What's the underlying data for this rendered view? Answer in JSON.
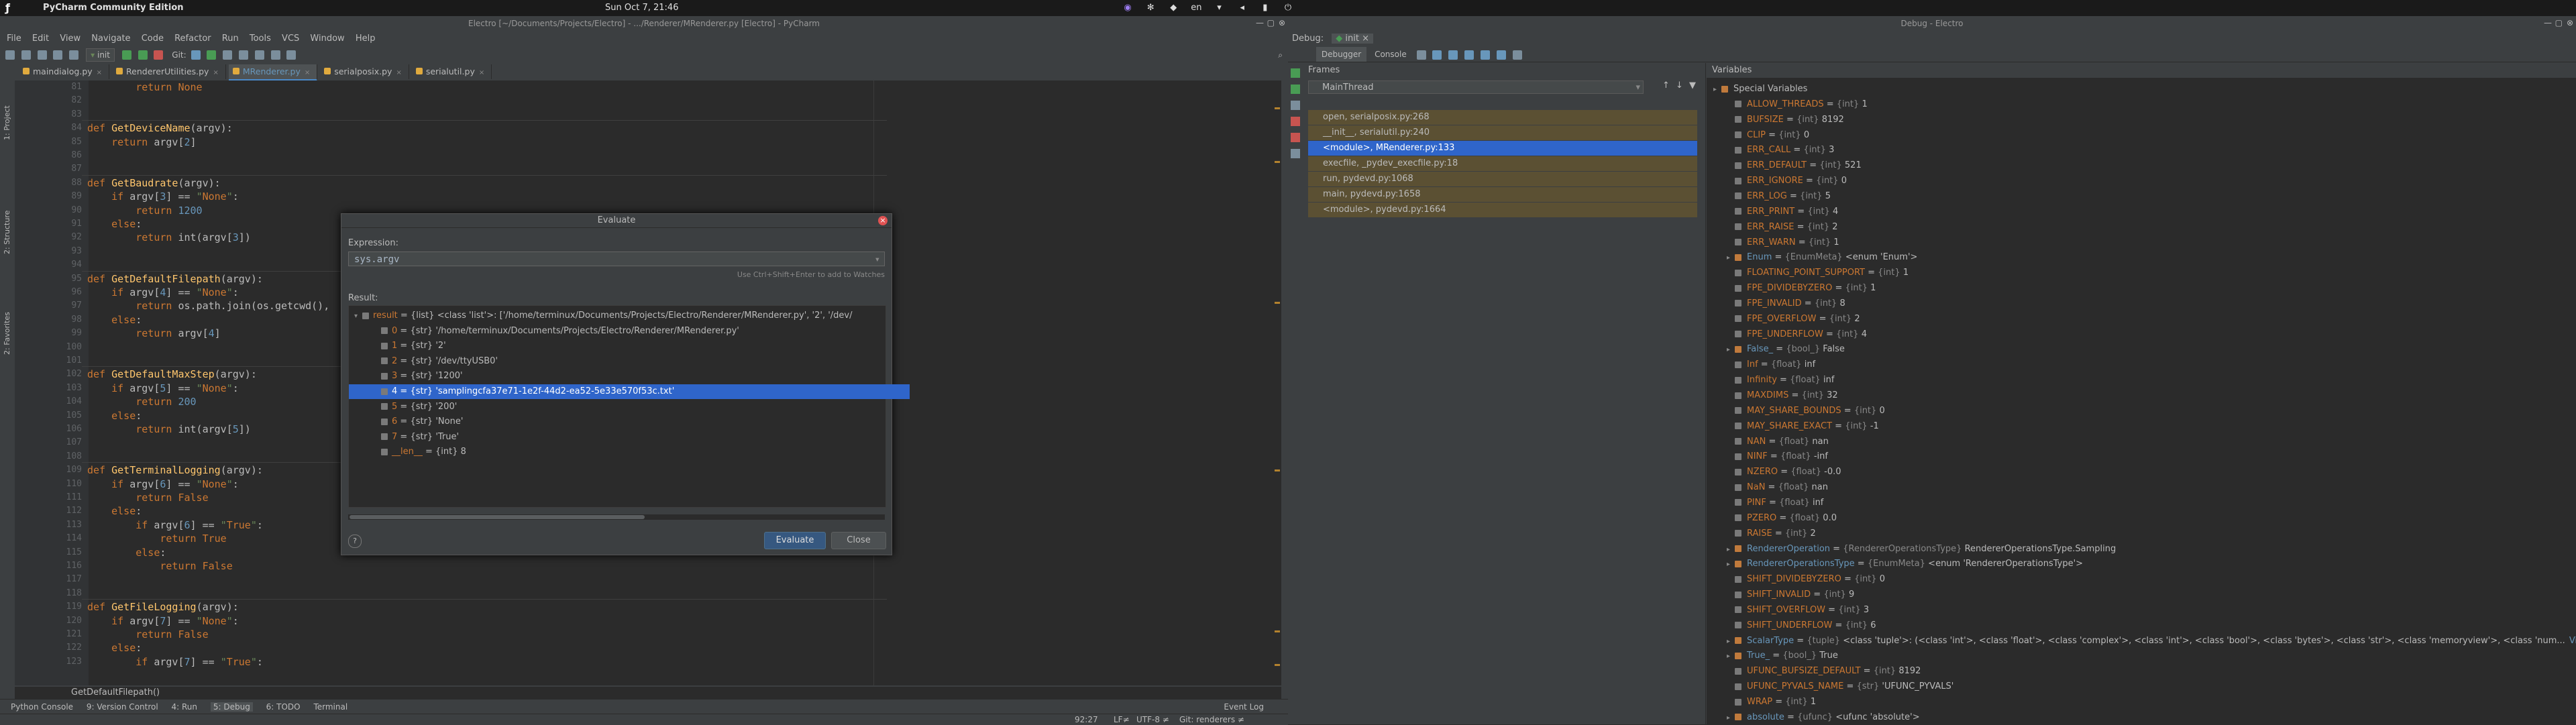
{
  "topbar": {
    "app_name": "PyCharm Community Edition",
    "clock": "Sun Oct  7, 21:46",
    "lang": "en"
  },
  "left_window": {
    "title": "Electro [~/Documents/Projects/Electro] - .../Renderer/MRenderer.py [Electro] - PyCharm",
    "menu": [
      "File",
      "Edit",
      "View",
      "Navigate",
      "Code",
      "Refactor",
      "Run",
      "Tools",
      "VCS",
      "Window",
      "Help"
    ],
    "run_config": "init",
    "git_label": "Git:",
    "tabs": [
      {
        "label": "maindialog.py",
        "active": false
      },
      {
        "label": "RendererUtilities.py",
        "active": false
      },
      {
        "label": "MRenderer.py",
        "active": true
      },
      {
        "label": "serialposix.py",
        "active": false
      },
      {
        "label": "serialutil.py",
        "active": false
      }
    ],
    "side_tools": [
      "1: Project",
      "2: Structure",
      "2: Favorites"
    ],
    "code_lines": [
      {
        "n": "81",
        "code": "        return None"
      },
      {
        "n": "82",
        "code": ""
      },
      {
        "n": "83",
        "code": ""
      },
      {
        "n": "84",
        "code": "def GetDeviceName(argv):"
      },
      {
        "n": "85",
        "code": "    return argv[2]"
      },
      {
        "n": "86",
        "code": ""
      },
      {
        "n": "87",
        "code": ""
      },
      {
        "n": "88",
        "code": "def GetBaudrate(argv):"
      },
      {
        "n": "89",
        "code": "    if argv[3] == \"None\":"
      },
      {
        "n": "90",
        "code": "        return 1200"
      },
      {
        "n": "91",
        "code": "    else:"
      },
      {
        "n": "92",
        "code": "        return int(argv[3])"
      },
      {
        "n": "93",
        "code": ""
      },
      {
        "n": "94",
        "code": ""
      },
      {
        "n": "95",
        "code": "def GetDefaultFilepath(argv):"
      },
      {
        "n": "96",
        "code": "    if argv[4] == \"None\":"
      },
      {
        "n": "97",
        "code": "        return os.path.join(os.getcwd(),"
      },
      {
        "n": "98",
        "code": "    else:"
      },
      {
        "n": "99",
        "code": "        return argv[4]"
      },
      {
        "n": "100",
        "code": ""
      },
      {
        "n": "101",
        "code": ""
      },
      {
        "n": "102",
        "code": "def GetDefaultMaxStep(argv):"
      },
      {
        "n": "103",
        "code": "    if argv[5] == \"None\":"
      },
      {
        "n": "104",
        "code": "        return 200"
      },
      {
        "n": "105",
        "code": "    else:"
      },
      {
        "n": "106",
        "code": "        return int(argv[5])"
      },
      {
        "n": "107",
        "code": ""
      },
      {
        "n": "108",
        "code": ""
      },
      {
        "n": "109",
        "code": "def GetTerminalLogging(argv):"
      },
      {
        "n": "110",
        "code": "    if argv[6] == \"None\":"
      },
      {
        "n": "111",
        "code": "        return False"
      },
      {
        "n": "112",
        "code": "    else:"
      },
      {
        "n": "113",
        "code": "        if argv[6] == \"True\":"
      },
      {
        "n": "114",
        "code": "            return True"
      },
      {
        "n": "115",
        "code": "        else:"
      },
      {
        "n": "116",
        "code": "            return False"
      },
      {
        "n": "117",
        "code": ""
      },
      {
        "n": "118",
        "code": ""
      },
      {
        "n": "119",
        "code": "def GetFileLogging(argv):"
      },
      {
        "n": "120",
        "code": "    if argv[7] == \"None\":"
      },
      {
        "n": "121",
        "code": "        return False"
      },
      {
        "n": "122",
        "code": "    else:"
      },
      {
        "n": "123",
        "code": "        if argv[7] == \"True\":"
      }
    ],
    "breadcrumb": "GetDefaultFilepath()",
    "bottom_tools": [
      "Python Console",
      "9: Version Control",
      "4: Run",
      "5: Debug",
      "6: TODO",
      "Terminal"
    ],
    "event_log": "Event Log",
    "status": {
      "position": "92:27",
      "line_sep": "LF≠",
      "encoding": "UTF-8 ≠",
      "git": "Git: renderers ≠"
    }
  },
  "dialog": {
    "title": "Evaluate",
    "expression_label": "Expression:",
    "expression": "sys.argv",
    "hint": "Use Ctrl+Shift+Enter to add to Watches",
    "result_label": "Result:",
    "result_rows": [
      {
        "name": "result",
        "text": " = {list} <class 'list'>: ['/home/terminux/Documents/Projects/Electro/Renderer/MRenderer.py', '2', '/dev/",
        "indent": 0,
        "expand": true,
        "selected": false
      },
      {
        "name": "0",
        "text": " = {str} '/home/terminux/Documents/Projects/Electro/Renderer/MRenderer.py'",
        "indent": 1,
        "expand": false,
        "selected": false
      },
      {
        "name": "1",
        "text": " = {str} '2'",
        "indent": 1,
        "expand": false,
        "selected": false
      },
      {
        "name": "2",
        "text": " = {str} '/dev/ttyUSB0'",
        "indent": 1,
        "expand": false,
        "selected": false
      },
      {
        "name": "3",
        "text": " = {str} '1200'",
        "indent": 1,
        "expand": false,
        "selected": false
      },
      {
        "name": "4",
        "text": " = {str} 'samplingcfa37e71-1e2f-44d2-ea52-5e33e570f53c.txt'",
        "indent": 1,
        "expand": false,
        "selected": true
      },
      {
        "name": "5",
        "text": " = {str} '200'",
        "indent": 1,
        "expand": false,
        "selected": false
      },
      {
        "name": "6",
        "text": " = {str} 'None'",
        "indent": 1,
        "expand": false,
        "selected": false
      },
      {
        "name": "7",
        "text": " = {str} 'True'",
        "indent": 1,
        "expand": false,
        "selected": false
      },
      {
        "name": "__len__",
        "text": " = {int} 8",
        "indent": 1,
        "expand": false,
        "selected": false
      }
    ],
    "help": "?",
    "evaluate_label": "Evaluate",
    "close_label": "Close"
  },
  "right_window": {
    "title": "Debug - Electro",
    "debug_label": "Debug:",
    "debug_config": "init",
    "tabs": [
      "Debugger",
      "Console"
    ],
    "frames_label": "Frames",
    "variables_label": "Variables",
    "thread": "MainThread",
    "frames": [
      {
        "label": "open, serialposix.py:268",
        "state": "normal"
      },
      {
        "label": "__init__, serialutil.py:240",
        "state": "normal"
      },
      {
        "label": "<module>, MRenderer.py:133",
        "state": "selected"
      },
      {
        "label": "execfile, _pydev_execfile.py:18",
        "state": "normal"
      },
      {
        "label": "run, pydevd.py:1068",
        "state": "normal"
      },
      {
        "label": "main, pydevd.py:1658",
        "state": "normal"
      },
      {
        "label": "<module>, pydevd.py:1664",
        "state": "normal"
      }
    ],
    "variables": [
      {
        "name": "Special Variables",
        "val": "",
        "type": "",
        "expand": true,
        "indent": 0,
        "obj": true,
        "plain": true
      },
      {
        "name": "ALLOW_THREADS",
        "type": "{int}",
        "val": "1",
        "expand": false,
        "indent": 1
      },
      {
        "name": "BUFSIZE",
        "type": "{int}",
        "val": "8192",
        "expand": false,
        "indent": 1
      },
      {
        "name": "CLIP",
        "type": "{int}",
        "val": "0",
        "expand": false,
        "indent": 1
      },
      {
        "name": "ERR_CALL",
        "type": "{int}",
        "val": "3",
        "expand": false,
        "indent": 1
      },
      {
        "name": "ERR_DEFAULT",
        "type": "{int}",
        "val": "521",
        "expand": false,
        "indent": 1
      },
      {
        "name": "ERR_IGNORE",
        "type": "{int}",
        "val": "0",
        "expand": false,
        "indent": 1
      },
      {
        "name": "ERR_LOG",
        "type": "{int}",
        "val": "5",
        "expand": false,
        "indent": 1
      },
      {
        "name": "ERR_PRINT",
        "type": "{int}",
        "val": "4",
        "expand": false,
        "indent": 1
      },
      {
        "name": "ERR_RAISE",
        "type": "{int}",
        "val": "2",
        "expand": false,
        "indent": 1
      },
      {
        "name": "ERR_WARN",
        "type": "{int}",
        "val": "1",
        "expand": false,
        "indent": 1
      },
      {
        "name": "Enum",
        "type": "{EnumMeta}",
        "val": "<enum 'Enum'>",
        "expand": true,
        "indent": 1,
        "blue": true
      },
      {
        "name": "FLOATING_POINT_SUPPORT",
        "type": "{int}",
        "val": "1",
        "expand": false,
        "indent": 1
      },
      {
        "name": "FPE_DIVIDEBYZERO",
        "type": "{int}",
        "val": "1",
        "expand": false,
        "indent": 1
      },
      {
        "name": "FPE_INVALID",
        "type": "{int}",
        "val": "8",
        "expand": false,
        "indent": 1
      },
      {
        "name": "FPE_OVERFLOW",
        "type": "{int}",
        "val": "2",
        "expand": false,
        "indent": 1
      },
      {
        "name": "FPE_UNDERFLOW",
        "type": "{int}",
        "val": "4",
        "expand": false,
        "indent": 1
      },
      {
        "name": "False_",
        "type": "{bool_}",
        "val": "False",
        "expand": true,
        "indent": 1,
        "blue": true
      },
      {
        "name": "Inf",
        "type": "{float}",
        "val": "inf",
        "expand": false,
        "indent": 1
      },
      {
        "name": "Infinity",
        "type": "{float}",
        "val": "inf",
        "expand": false,
        "indent": 1
      },
      {
        "name": "MAXDIMS",
        "type": "{int}",
        "val": "32",
        "expand": false,
        "indent": 1
      },
      {
        "name": "MAY_SHARE_BOUNDS",
        "type": "{int}",
        "val": "0",
        "expand": false,
        "indent": 1
      },
      {
        "name": "MAY_SHARE_EXACT",
        "type": "{int}",
        "val": "-1",
        "expand": false,
        "indent": 1
      },
      {
        "name": "NAN",
        "type": "{float}",
        "val": "nan",
        "expand": false,
        "indent": 1
      },
      {
        "name": "NINF",
        "type": "{float}",
        "val": "-inf",
        "expand": false,
        "indent": 1
      },
      {
        "name": "NZERO",
        "type": "{float}",
        "val": "-0.0",
        "expand": false,
        "indent": 1
      },
      {
        "name": "NaN",
        "type": "{float}",
        "val": "nan",
        "expand": false,
        "indent": 1
      },
      {
        "name": "PINF",
        "type": "{float}",
        "val": "inf",
        "expand": false,
        "indent": 1
      },
      {
        "name": "PZERO",
        "type": "{float}",
        "val": "0.0",
        "expand": false,
        "indent": 1
      },
      {
        "name": "RAISE",
        "type": "{int}",
        "val": "2",
        "expand": false,
        "indent": 1
      },
      {
        "name": "RendererOperation",
        "type": "{RendererOperationsType}",
        "val": "RendererOperationsType.Sampling",
        "expand": true,
        "indent": 1,
        "blue": true
      },
      {
        "name": "RendererOperationsType",
        "type": "{EnumMeta}",
        "val": "<enum 'RendererOperationsType'>",
        "expand": true,
        "indent": 1,
        "blue": true
      },
      {
        "name": "SHIFT_DIVIDEBYZERO",
        "type": "{int}",
        "val": "0",
        "expand": false,
        "indent": 1
      },
      {
        "name": "SHIFT_INVALID",
        "type": "{int}",
        "val": "9",
        "expand": false,
        "indent": 1
      },
      {
        "name": "SHIFT_OVERFLOW",
        "type": "{int}",
        "val": "3",
        "expand": false,
        "indent": 1
      },
      {
        "name": "SHIFT_UNDERFLOW",
        "type": "{int}",
        "val": "6",
        "expand": false,
        "indent": 1
      },
      {
        "name": "ScalarType",
        "type": "{tuple}",
        "val": "<class 'tuple'>: (<class 'int'>, <class 'float'>, <class 'complex'>, <class 'int'>, <class 'bool'>, <class 'bytes'>, <class 'str'>, <class 'memoryview'>, <class 'num...",
        "expand": true,
        "indent": 1,
        "blue": true,
        "view": "View"
      },
      {
        "name": "True_",
        "type": "{bool_}",
        "val": "True",
        "expand": true,
        "indent": 1,
        "blue": true
      },
      {
        "name": "UFUNC_BUFSIZE_DEFAULT",
        "type": "{int}",
        "val": "8192",
        "expand": false,
        "indent": 1
      },
      {
        "name": "UFUNC_PYVALS_NAME",
        "type": "{str}",
        "val": "'UFUNC_PYVALS'",
        "expand": false,
        "indent": 1
      },
      {
        "name": "WRAP",
        "type": "{int}",
        "val": "1",
        "expand": false,
        "indent": 1
      },
      {
        "name": "absolute",
        "type": "{ufunc}",
        "val": "<ufunc 'absolute'>",
        "expand": true,
        "indent": 1,
        "blue": true
      }
    ]
  }
}
